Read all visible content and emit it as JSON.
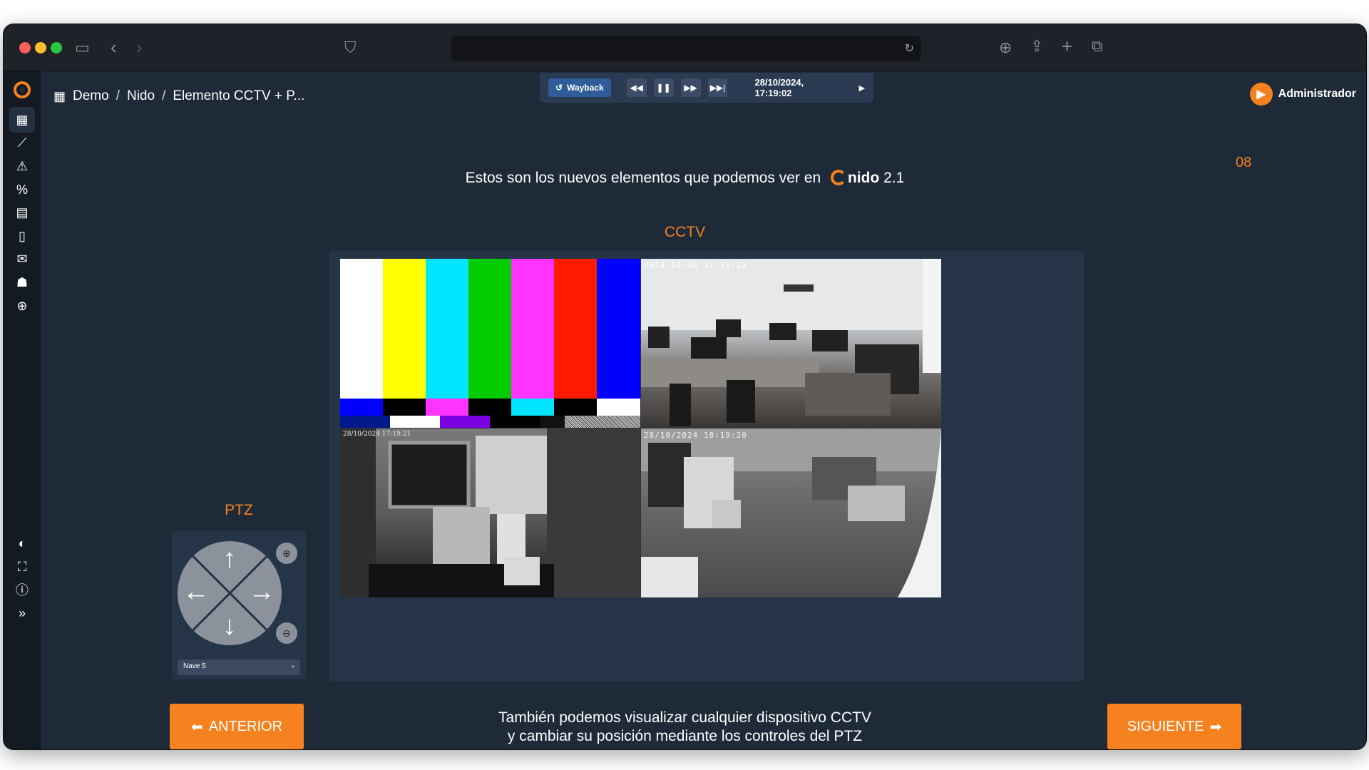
{
  "browser": {
    "url": ""
  },
  "breadcrumb": {
    "items": [
      "Demo",
      "Nido",
      "Elemento CCTV + P..."
    ],
    "separator": "/"
  },
  "playback": {
    "wayback_label": "Wayback",
    "datetime": "28/10/2024, 17:19:02"
  },
  "user": {
    "name": "Administrador"
  },
  "page_number": "08",
  "headline": {
    "text": "Estos son los nuevos elementos que podemos ver en",
    "brand": "nido",
    "version": "2.1"
  },
  "cctv": {
    "title": "CCTV",
    "cameras": [
      {
        "timestamp": ""
      },
      {
        "timestamp": "2024-10-28 17:19:23"
      },
      {
        "timestamp": "28/10/2024 17:19:21"
      },
      {
        "timestamp": "28/10/2024 18:19:20"
      }
    ]
  },
  "ptz": {
    "title": "PTZ",
    "selected_device": "Nave 5"
  },
  "navigation": {
    "prev_label": "ANTERIOR",
    "next_label": "SIGUIENTE"
  },
  "footer": {
    "line1": "También podemos visualizar cualquier dispositivo CCTV",
    "line2": "y cambiar su posición mediante los controles del PTZ"
  },
  "colors": {
    "accent": "#f6821f",
    "background": "#1f2a38"
  }
}
